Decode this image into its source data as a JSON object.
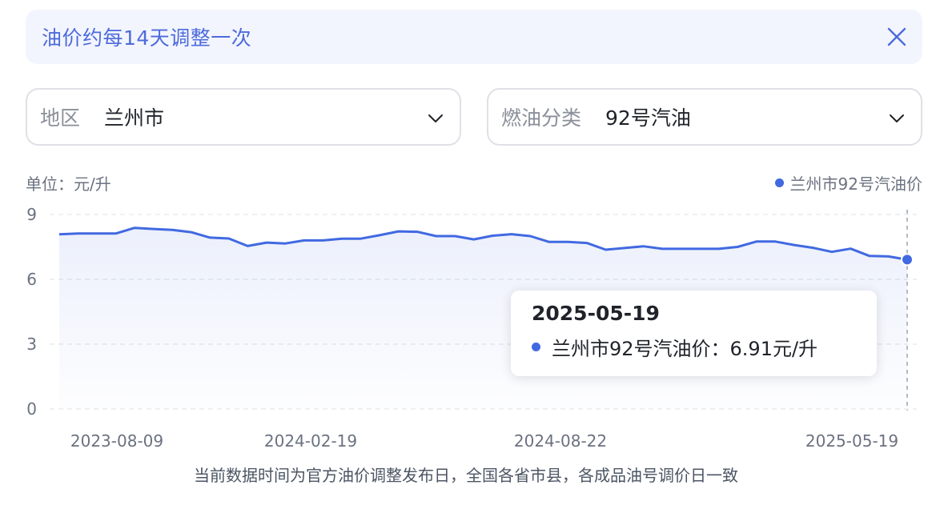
{
  "notice": {
    "text": "油价约每14天调整一次",
    "close_icon": "close-icon"
  },
  "filters": {
    "region": {
      "label": "地区",
      "value": "兰州市",
      "icon": "chevron-down-icon"
    },
    "fuel": {
      "label": "燃油分类",
      "value": "92号汽油",
      "icon": "chevron-down-icon"
    }
  },
  "unit_label": "单位：元/升",
  "legend_label": "兰州市92号汽油价",
  "colors": {
    "accent": "#4169e1",
    "notice_text": "#4d6bdc"
  },
  "chart_data": {
    "type": "area",
    "title": "",
    "xlabel": "",
    "ylabel": "元/升",
    "ylim": [
      0,
      9
    ],
    "y_ticks": [
      "0",
      "3",
      "6",
      "9"
    ],
    "x_tick_labels": [
      "2023-08-09",
      "2024-02-19",
      "2024-08-22",
      "2025-05-19"
    ],
    "grid": true,
    "legend_position": "top-right",
    "series": [
      {
        "name": "兰州市92号汽油价",
        "values": [
          8.08,
          8.12,
          8.12,
          8.12,
          8.38,
          8.33,
          8.29,
          8.18,
          7.93,
          7.89,
          7.54,
          7.7,
          7.66,
          7.8,
          7.8,
          7.88,
          7.88,
          8.04,
          8.22,
          8.2,
          8.0,
          8.0,
          7.85,
          8.02,
          8.09,
          8.0,
          7.73,
          7.73,
          7.68,
          7.37,
          7.45,
          7.53,
          7.41,
          7.41,
          7.41,
          7.41,
          7.5,
          7.75,
          7.75,
          7.59,
          7.46,
          7.27,
          7.42,
          7.08,
          7.06,
          6.91
        ]
      }
    ]
  },
  "tooltip": {
    "date": "2025-05-19",
    "text": "兰州市92号汽油价：6.91元/升"
  },
  "footnote": "当前数据时间为官方油价调整发布日，全国各省市县，各成品油号调价日一致"
}
